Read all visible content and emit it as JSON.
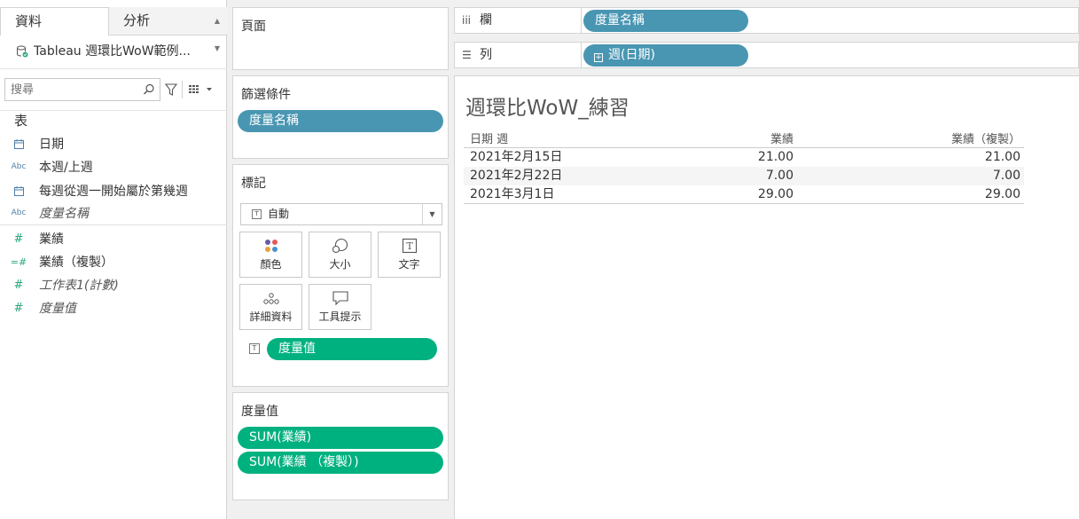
{
  "data_pane": {
    "tabs": [
      {
        "label": "資料",
        "active": true
      },
      {
        "label": "分析",
        "active": false
      }
    ],
    "datasource": "Tableau 週環比WoW範例...",
    "search": {
      "placeholder": "搜尋"
    },
    "section_label": "表",
    "dimensions": [
      {
        "icon": "date-icon",
        "label": "日期"
      },
      {
        "icon": "abc-icon",
        "label": "本週/上週"
      },
      {
        "icon": "date-icon",
        "label": "每週從週一開始屬於第幾週"
      },
      {
        "icon": "abc-icon",
        "label": "度量名稱"
      }
    ],
    "measures": [
      {
        "icon": "number-icon",
        "label": "業績"
      },
      {
        "icon": "number-calc-icon",
        "label": "業績（複製）"
      },
      {
        "icon": "number-icon",
        "label": "工作表1(計數)"
      },
      {
        "icon": "number-icon",
        "label": "度量值"
      }
    ]
  },
  "pages_card": {
    "title": "頁面"
  },
  "filters_card": {
    "title": "篩選條件",
    "pills": [
      "度量名稱"
    ]
  },
  "marks_card": {
    "title": "標記",
    "mark_type": "自動",
    "buttons": [
      {
        "icon": "color-icon",
        "label": "顏色"
      },
      {
        "icon": "size-icon",
        "label": "大小"
      },
      {
        "icon": "text-icon",
        "label": "文字"
      },
      {
        "icon": "detail-icon",
        "label": "詳細資料"
      },
      {
        "icon": "tooltip-icon",
        "label": "工具提示"
      }
    ],
    "text_pill": "度量值"
  },
  "measure_values_card": {
    "title": "度量值",
    "pills": [
      "SUM(業績)",
      "SUM(業績 （複製）)"
    ]
  },
  "columns_shelf": {
    "label": "欄",
    "pill": "度量名稱"
  },
  "rows_shelf": {
    "label": "列",
    "pill": "週(日期)"
  },
  "viz": {
    "title": "週環比WoW_練習",
    "headers": [
      "日期 週",
      "業績",
      "業績（複製）"
    ],
    "rows": [
      [
        "2021年2月15日",
        "21.00",
        "21.00"
      ],
      [
        "2021年2月22日",
        "7.00",
        "7.00"
      ],
      [
        "2021年3月1日",
        "29.00",
        "29.00"
      ]
    ]
  },
  "colors": {
    "dimension_pill": "#4996b2",
    "measure_pill": "#00b180"
  }
}
